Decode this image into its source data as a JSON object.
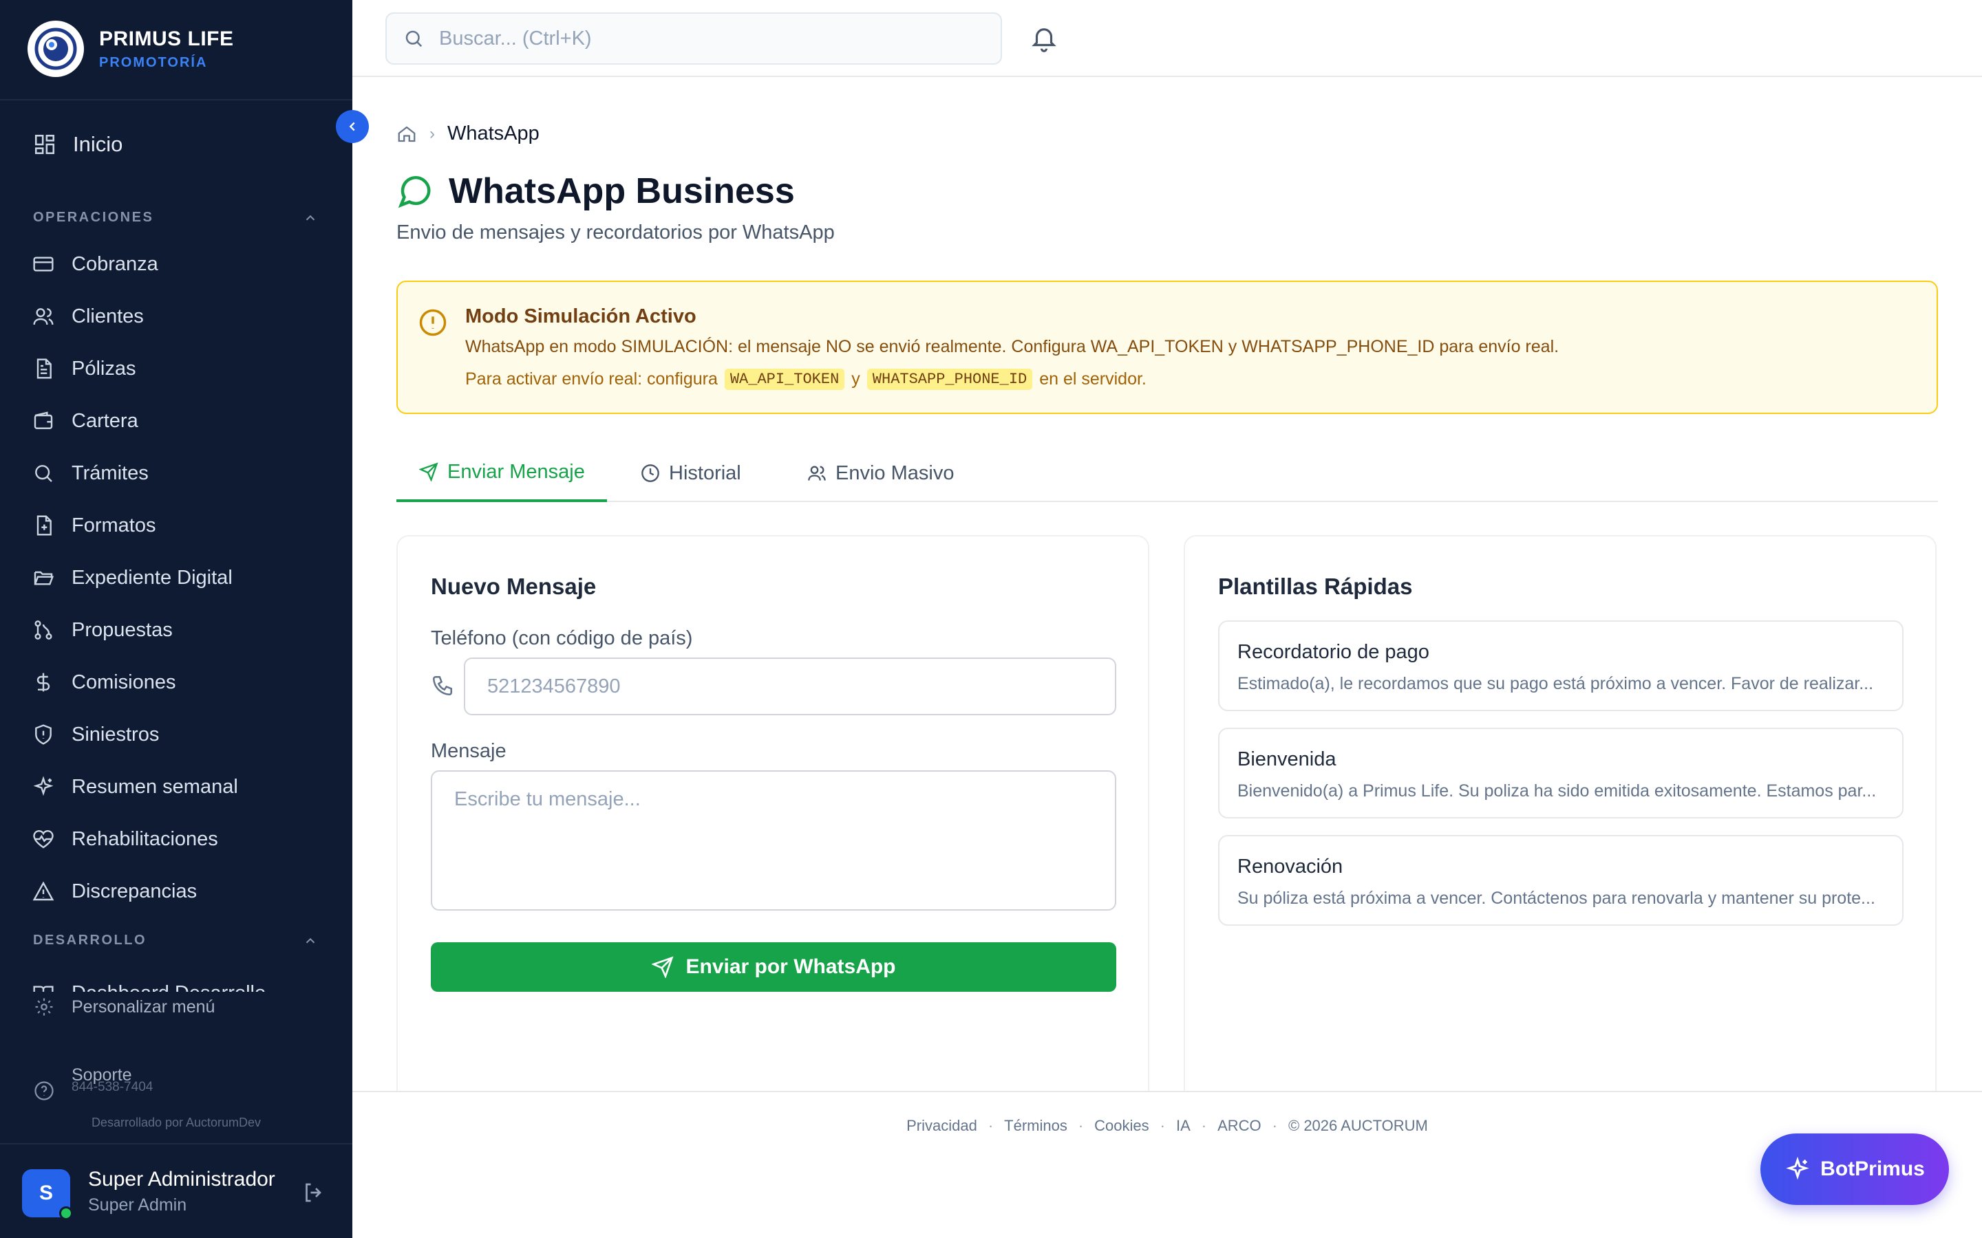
{
  "brand": {
    "name": "PRIMUS LIFE",
    "subtitle": "PROMOTORÍA"
  },
  "sidebar": {
    "home": "Inicio",
    "sections": [
      {
        "title": "OPERACIONES"
      },
      {
        "title": "DESARROLLO"
      }
    ],
    "items": [
      {
        "label": "Cobranza",
        "icon": "credit-card-icon"
      },
      {
        "label": "Clientes",
        "icon": "users-icon"
      },
      {
        "label": "Pólizas",
        "icon": "document-icon"
      },
      {
        "label": "Cartera",
        "icon": "wallet-icon"
      },
      {
        "label": "Trámites",
        "icon": "search-icon"
      },
      {
        "label": "Formatos",
        "icon": "file-plus-icon"
      },
      {
        "label": "Expediente Digital",
        "icon": "folder-open-icon"
      },
      {
        "label": "Propuestas",
        "icon": "git-branch-icon"
      },
      {
        "label": "Comisiones",
        "icon": "dollar-icon"
      },
      {
        "label": "Siniestros",
        "icon": "shield-icon"
      },
      {
        "label": "Resumen semanal",
        "icon": "sparkles-icon"
      },
      {
        "label": "Rehabilitaciones",
        "icon": "heart-pulse-icon"
      },
      {
        "label": "Discrepancias",
        "icon": "warning-icon"
      }
    ],
    "dev_item": "Dashboard Desarrollo",
    "customize": "Personalizar menú",
    "support": "Soporte",
    "support_phone": "844-538-7404",
    "developed_by": "Desarrollado por AuctorumDev",
    "user": {
      "initial": "S",
      "name": "Super Administrador",
      "role": "Super Admin"
    }
  },
  "topbar": {
    "search_placeholder": "Buscar... (Ctrl+K)"
  },
  "breadcrumb": {
    "current": "WhatsApp"
  },
  "page": {
    "title": "WhatsApp Business",
    "subtitle": "Envio de mensajes y recordatorios por WhatsApp"
  },
  "alert": {
    "title": "Modo Simulación Activo",
    "text": "WhatsApp en modo SIMULACIÓN: el mensaje NO se envió realmente. Configura WA_API_TOKEN y WHATSAPP_PHONE_ID para envío real.",
    "line2_prefix": "Para activar envío real: configura",
    "code1": "WA_API_TOKEN",
    "and": "y",
    "code2": "WHATSAPP_PHONE_ID",
    "line2_suffix": "en el servidor."
  },
  "tabs": [
    {
      "label": "Enviar Mensaje",
      "active": true
    },
    {
      "label": "Historial",
      "active": false
    },
    {
      "label": "Envio Masivo",
      "active": false
    }
  ],
  "new_message": {
    "title": "Nuevo Mensaje",
    "phone_label": "Teléfono (con código de país)",
    "phone_placeholder": "521234567890",
    "message_label": "Mensaje",
    "message_placeholder": "Escribe tu mensaje...",
    "send_label": "Enviar por WhatsApp"
  },
  "templates": {
    "title": "Plantillas Rápidas",
    "items": [
      {
        "title": "Recordatorio de pago",
        "body": "Estimado(a), le recordamos que su pago está próximo a vencer. Favor de realizar..."
      },
      {
        "title": "Bienvenida",
        "body": "Bienvenido(a) a Primus Life. Su poliza ha sido emitida exitosamente. Estamos par..."
      },
      {
        "title": "Renovación",
        "body": "Su póliza está próxima a vencer. Contáctenos para renovarla y mantener su prote..."
      }
    ]
  },
  "footer": {
    "links": [
      "Privacidad",
      "Términos",
      "Cookies",
      "IA",
      "ARCO"
    ],
    "copyright": "© 2026 AUCTORUM"
  },
  "assistant": {
    "label": "BotPrimus"
  },
  "colors": {
    "sidebar_bg": "#0f1b33",
    "accent_blue": "#2563eb",
    "whatsapp_green": "#16a34a",
    "alert_bg": "#fefce8",
    "alert_border": "#facc15"
  }
}
